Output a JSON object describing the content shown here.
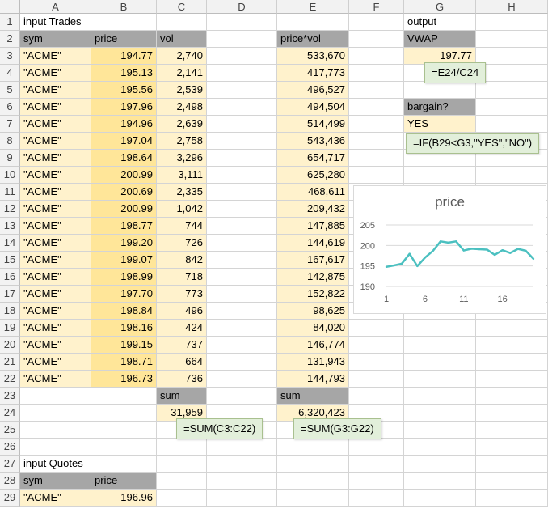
{
  "columns": [
    "A",
    "B",
    "C",
    "D",
    "E",
    "F",
    "G",
    "H"
  ],
  "rows": [
    "1",
    "2",
    "3",
    "4",
    "5",
    "6",
    "7",
    "8",
    "9",
    "10",
    "11",
    "12",
    "13",
    "14",
    "15",
    "16",
    "17",
    "18",
    "19",
    "20",
    "21",
    "22",
    "23",
    "24",
    "25",
    "26",
    "27",
    "28",
    "29"
  ],
  "trades": {
    "title": "input Trades",
    "headers": {
      "sym": "sym",
      "price": "price",
      "vol": "vol"
    },
    "rows": [
      {
        "sym": "\"ACME\"",
        "price": "194.77",
        "vol": "2,740",
        "pv": "533,670"
      },
      {
        "sym": "\"ACME\"",
        "price": "195.13",
        "vol": "2,141",
        "pv": "417,773"
      },
      {
        "sym": "\"ACME\"",
        "price": "195.56",
        "vol": "2,539",
        "pv": "496,527"
      },
      {
        "sym": "\"ACME\"",
        "price": "197.96",
        "vol": "2,498",
        "pv": "494,504"
      },
      {
        "sym": "\"ACME\"",
        "price": "194.96",
        "vol": "2,639",
        "pv": "514,499"
      },
      {
        "sym": "\"ACME\"",
        "price": "197.04",
        "vol": "2,758",
        "pv": "543,436"
      },
      {
        "sym": "\"ACME\"",
        "price": "198.64",
        "vol": "3,296",
        "pv": "654,717"
      },
      {
        "sym": "\"ACME\"",
        "price": "200.99",
        "vol": "3,111",
        "pv": "625,280"
      },
      {
        "sym": "\"ACME\"",
        "price": "200.69",
        "vol": "2,335",
        "pv": "468,611"
      },
      {
        "sym": "\"ACME\"",
        "price": "200.99",
        "vol": "1,042",
        "pv": "209,432"
      },
      {
        "sym": "\"ACME\"",
        "price": "198.77",
        "vol": "744",
        "pv": "147,885"
      },
      {
        "sym": "\"ACME\"",
        "price": "199.20",
        "vol": "726",
        "pv": "144,619"
      },
      {
        "sym": "\"ACME\"",
        "price": "199.07",
        "vol": "842",
        "pv": "167,617"
      },
      {
        "sym": "\"ACME\"",
        "price": "198.99",
        "vol": "718",
        "pv": "142,875"
      },
      {
        "sym": "\"ACME\"",
        "price": "197.70",
        "vol": "773",
        "pv": "152,822"
      },
      {
        "sym": "\"ACME\"",
        "price": "198.84",
        "vol": "496",
        "pv": "98,625"
      },
      {
        "sym": "\"ACME\"",
        "price": "198.16",
        "vol": "424",
        "pv": "84,020"
      },
      {
        "sym": "\"ACME\"",
        "price": "199.15",
        "vol": "737",
        "pv": "146,774"
      },
      {
        "sym": "\"ACME\"",
        "price": "198.71",
        "vol": "664",
        "pv": "131,943"
      },
      {
        "sym": "\"ACME\"",
        "price": "196.73",
        "vol": "736",
        "pv": "144,793"
      }
    ],
    "pv_header": "price*vol",
    "sum_label_c": "sum",
    "sum_value_c": "31,959",
    "sum_label_e": "sum",
    "sum_value_e": "6,320,423",
    "formula_c": "=SUM(C3:C22)",
    "formula_e": "=SUM(G3:G22)"
  },
  "output": {
    "title": "output",
    "vwap_label": "VWAP",
    "vwap_value": "197.77",
    "vwap_formula": "=E24/C24",
    "bargain_label": "bargain?",
    "bargain_value": "YES",
    "bargain_formula": "=IF(B29<G3,\"YES\",\"NO\")"
  },
  "quotes": {
    "title": "input Quotes",
    "sym_header": "sym",
    "price_header": "price",
    "sym": "\"ACME\"",
    "price": "196.96"
  },
  "chart_data": {
    "type": "line",
    "title": "price",
    "x": [
      1,
      2,
      3,
      4,
      5,
      6,
      7,
      8,
      9,
      10,
      11,
      12,
      13,
      14,
      15,
      16,
      17,
      18,
      19,
      20
    ],
    "series": [
      {
        "values": [
          194.77,
          195.13,
          195.56,
          197.96,
          194.96,
          197.04,
          198.64,
          200.99,
          200.69,
          200.99,
          198.77,
          199.2,
          199.07,
          198.99,
          197.7,
          198.84,
          198.16,
          199.15,
          198.71,
          196.73
        ]
      }
    ],
    "ylim": [
      190,
      205
    ],
    "yticks": [
      "190",
      "195",
      "200",
      "205"
    ],
    "xticks": [
      "1",
      "6",
      "11",
      "16"
    ],
    "xtick_values": [
      1,
      6,
      11,
      16
    ],
    "ytick_values": [
      190,
      195,
      200,
      205
    ],
    "line_color": "#4bc0c0",
    "grid": true
  }
}
